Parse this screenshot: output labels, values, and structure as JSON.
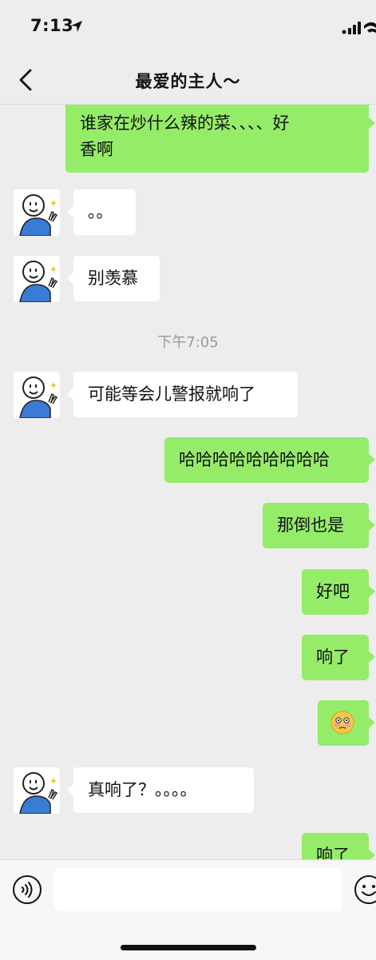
{
  "status_bar": {
    "time": "7:13"
  },
  "header": {
    "title": "最爱的主人～"
  },
  "messages": [
    {
      "side": "right",
      "text_lines": [
        "谁家在炒什么辣的菜、、、、好",
        "香啊"
      ]
    },
    {
      "side": "left",
      "text": "。。"
    },
    {
      "side": "left",
      "text": "别羡慕"
    },
    {
      "type": "timestamp",
      "text": "下午7:05"
    },
    {
      "side": "left",
      "text": "可能等会儿警报就响了"
    },
    {
      "side": "right",
      "text": "哈哈哈哈哈哈哈哈哈"
    },
    {
      "side": "right",
      "text": "那倒也是"
    },
    {
      "side": "right",
      "text": "好吧"
    },
    {
      "side": "right",
      "text": "响了"
    },
    {
      "side": "right",
      "emoji": "flushed-face"
    },
    {
      "side": "left",
      "text": "真响了？。。。。"
    },
    {
      "side": "right",
      "text": "响了"
    }
  ],
  "input": {
    "placeholder": ""
  },
  "colors": {
    "sent_bubble": "#95ec69",
    "received_bubble": "#ffffff",
    "background": "#ededed"
  }
}
